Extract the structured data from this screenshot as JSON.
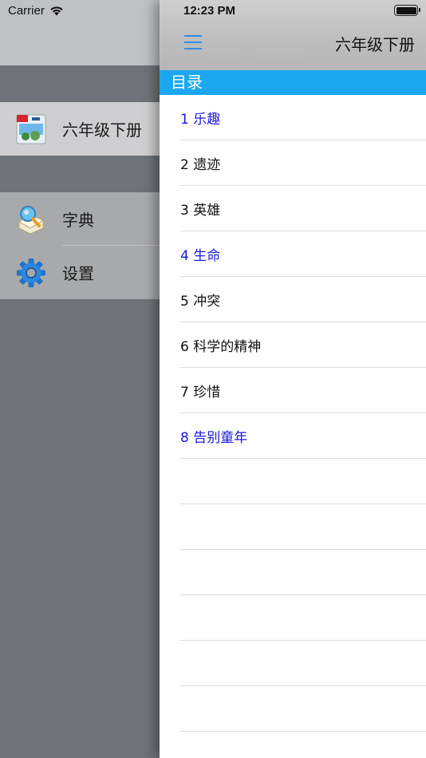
{
  "status_bar": {
    "carrier": "Carrier",
    "time": "12:23 PM"
  },
  "menu": {
    "items": [
      {
        "label": "六年级下册",
        "icon": "book-cover-icon",
        "selected": true
      },
      {
        "label": "字典",
        "icon": "dictionary-icon",
        "selected": false
      },
      {
        "label": "设置",
        "icon": "gear-icon",
        "selected": false
      }
    ]
  },
  "nav": {
    "title": "六年级下册",
    "menu_icon": "hamburger-icon"
  },
  "section": {
    "header": "目录"
  },
  "chapters": [
    {
      "label": "1 乐趣",
      "highlight": true
    },
    {
      "label": "2 遗迹",
      "highlight": false
    },
    {
      "label": "3 英雄",
      "highlight": false
    },
    {
      "label": "4 生命",
      "highlight": true
    },
    {
      "label": "5 冲突",
      "highlight": false
    },
    {
      "label": "6 科学的精神",
      "highlight": false
    },
    {
      "label": "7 珍惜",
      "highlight": false
    },
    {
      "label": "8 告别童年",
      "highlight": true
    },
    {
      "label": "",
      "highlight": false
    },
    {
      "label": "",
      "highlight": false
    },
    {
      "label": "",
      "highlight": false
    },
    {
      "label": "",
      "highlight": false
    },
    {
      "label": "",
      "highlight": false
    },
    {
      "label": "",
      "highlight": false
    }
  ],
  "colors": {
    "accent": "#1aa7ef",
    "highlight_text": "#1a1adb",
    "menu_icon": "#2f8fe6"
  }
}
